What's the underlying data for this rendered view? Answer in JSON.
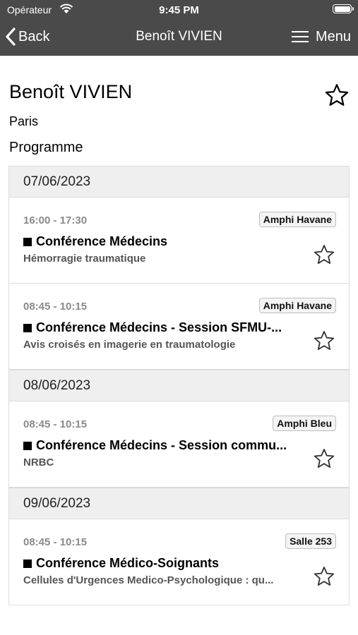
{
  "status_bar": {
    "carrier": "Opérateur",
    "time": "9:45 PM"
  },
  "nav": {
    "back_label": "Back",
    "title": "Benoît VIVIEN",
    "menu_label": "Menu"
  },
  "speaker": {
    "name": "Benoît VIVIEN",
    "city": "Paris"
  },
  "section_title": "Programme",
  "days": [
    {
      "date": "07/06/2023",
      "sessions": [
        {
          "time": "16:00 - 17:30",
          "room": "Amphi Havane",
          "title": "Conférence Médecins",
          "subtitle": "Hémorragie traumatique"
        },
        {
          "time": "08:45 - 10:15",
          "room": "Amphi Havane",
          "title": "Conférence Médecins - Session SFMU-...",
          "subtitle": "Avis croisés en imagerie en traumatologie"
        }
      ]
    },
    {
      "date": "08/06/2023",
      "sessions": [
        {
          "time": "08:45 - 10:15",
          "room": "Amphi Bleu",
          "title": "Conférence Médecins - Session commu...",
          "subtitle": "NRBC"
        }
      ]
    },
    {
      "date": "09/06/2023",
      "sessions": [
        {
          "time": "08:45 - 10:15",
          "room": "Salle 253",
          "title": "Conférence Médico-Soignants",
          "subtitle": "Cellules d'Urgences Medico-Psychologique : qu..."
        }
      ]
    }
  ],
  "colors": {
    "nav_background": "#4a4a4a",
    "day_header_background": "#efefef"
  }
}
